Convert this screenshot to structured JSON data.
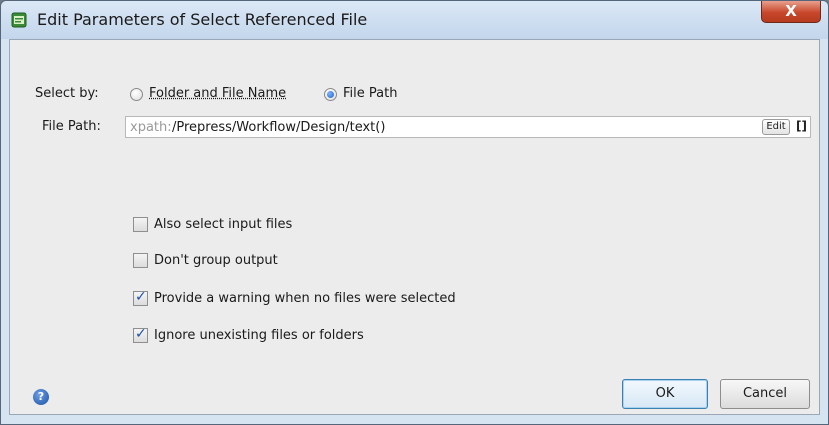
{
  "window": {
    "title": "Edit Parameters of Select Referenced File",
    "close_label": "X"
  },
  "select_by": {
    "label": "Select by:",
    "options": [
      {
        "label": "Folder and File Name",
        "selected": false
      },
      {
        "label": "File Path",
        "selected": true
      }
    ]
  },
  "file_path": {
    "label": "File Path:",
    "prefix": "xpath:",
    "value": "/Prepress/Workflow/Design/text()",
    "edit_label": "Edit",
    "brackets_label": "[]"
  },
  "checkboxes": [
    {
      "label": "Also select input files",
      "checked": false
    },
    {
      "label": "Don't group output",
      "checked": false
    },
    {
      "label": "Provide a warning when no files were selected",
      "checked": true
    },
    {
      "label": "Ignore unexisting files or folders",
      "checked": true
    }
  ],
  "footer": {
    "help_icon_glyph": "?",
    "ok_label": "OK",
    "cancel_label": "Cancel"
  },
  "colors": {
    "title_bar": "#c3d6ec",
    "close_button": "#c8472b",
    "client_bg": "#ececec",
    "check_mark": "#1b4fa8"
  }
}
